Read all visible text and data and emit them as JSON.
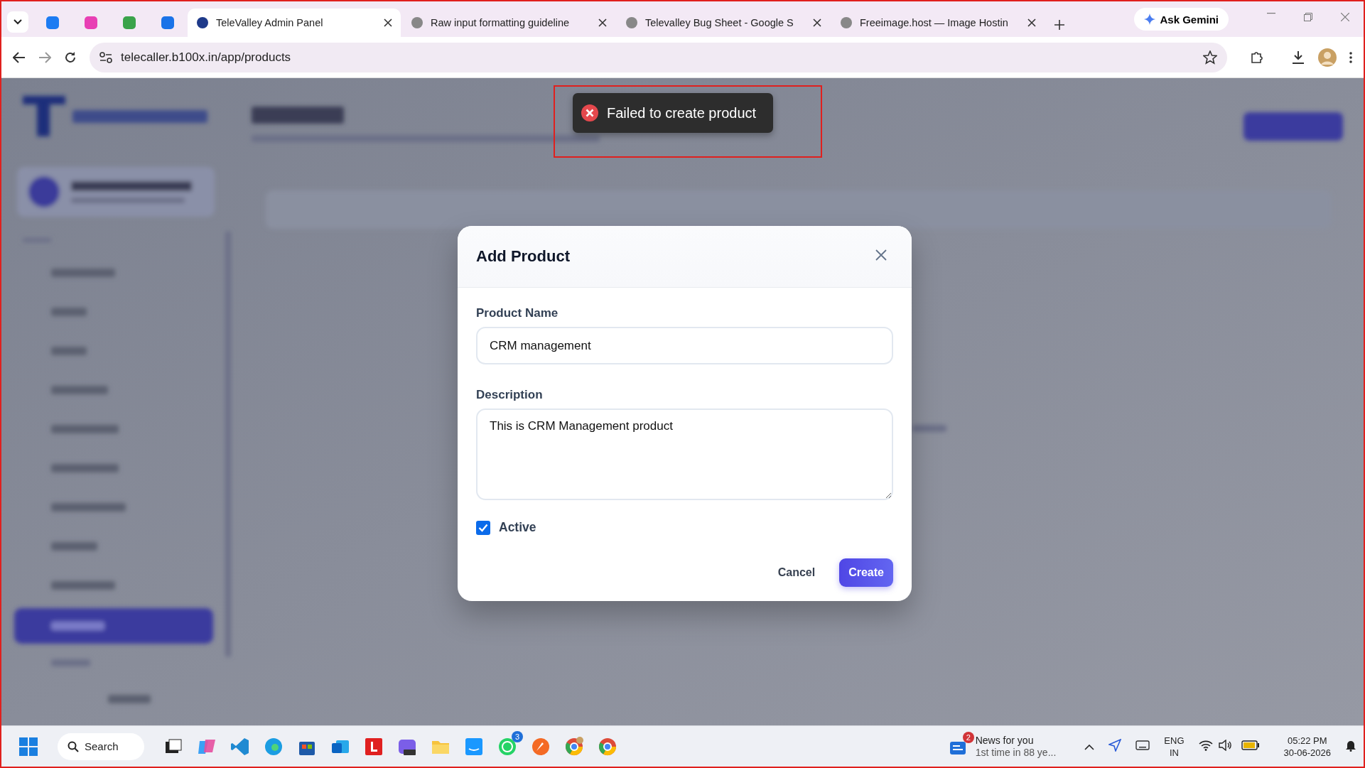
{
  "browser": {
    "tabs": [
      {
        "kind": "pinned",
        "selected": false
      },
      {
        "kind": "pinned",
        "selected": false
      },
      {
        "kind": "pinned",
        "selected": false
      },
      {
        "kind": "pinned",
        "selected": false
      },
      {
        "kind": "page",
        "title": "TeleValley Admin Panel",
        "selected": true
      },
      {
        "kind": "page",
        "title": "Raw input formatting guideline",
        "selected": false
      },
      {
        "kind": "page",
        "title": "Televalley Bug Sheet - Google S",
        "selected": false
      },
      {
        "kind": "page",
        "title": "Freeimage.host — Image Hostin",
        "selected": false
      }
    ],
    "gemini_button": "Ask Gemini",
    "url": "telecaller.b100x.in/app/products"
  },
  "toast": {
    "kind": "error",
    "message": "Failed to create product",
    "highlighted": true
  },
  "dialog": {
    "title": "Add Product",
    "fields": [
      {
        "kind": "input",
        "label": "Product Name",
        "value": "CRM management"
      },
      {
        "kind": "textarea",
        "label": "Description",
        "value": "This is CRM Management product"
      }
    ],
    "active": {
      "label": "Active",
      "checked": true
    },
    "buttons": [
      {
        "kind": "secondary",
        "label": "Cancel"
      },
      {
        "kind": "primary",
        "label": "Create"
      }
    ]
  },
  "taskbar": {
    "search": "Search",
    "app_badge": "3",
    "news_badge": "2",
    "news_title": "News for you",
    "news_text": "1st time in 88 ye...",
    "language": "ENG",
    "region": "IN",
    "time": "05:22 PM",
    "date": "30-06-2026"
  }
}
